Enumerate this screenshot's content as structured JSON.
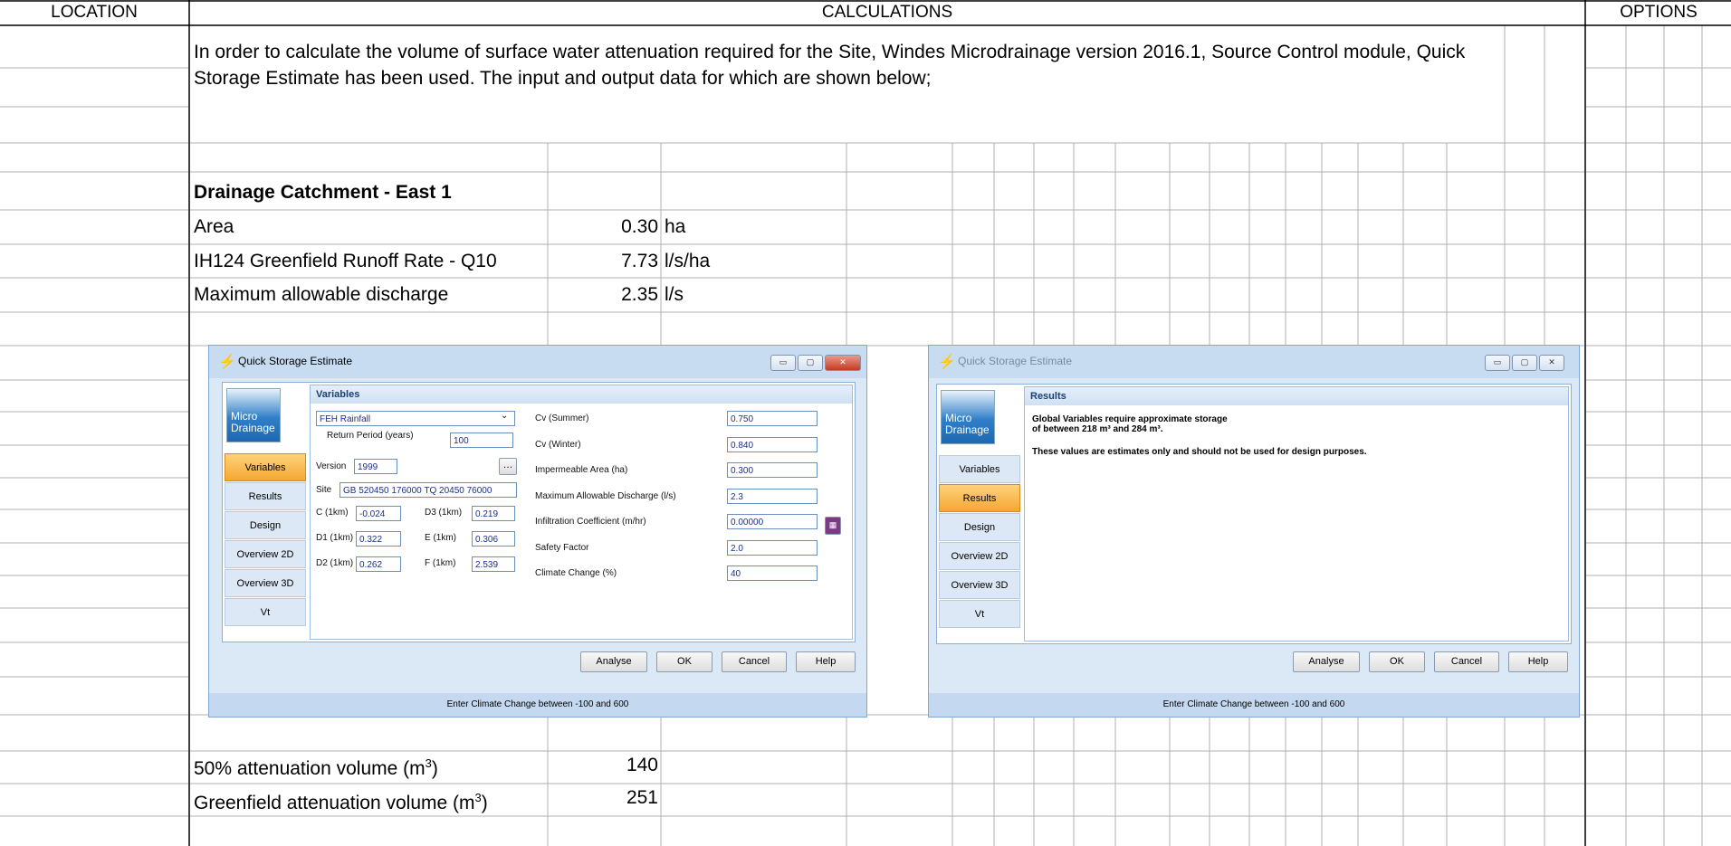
{
  "headers": {
    "location": "LOCATION",
    "calculations": "CALCULATIONS",
    "options": "OPTIONS"
  },
  "intro": "In order to calculate the volume of surface water attenuation required for the Site, Windes Microdrainage version 2016.1, Source Control module, Quick Storage Estimate has been used. The input and output data for which are shown below;",
  "catchment": {
    "title": "Drainage Catchment - East 1",
    "rows": [
      {
        "label": "Area",
        "value": "0.30",
        "unit": "ha"
      },
      {
        "label": "IH124 Greenfield Runoff Rate - Q10",
        "value": "7.73",
        "unit": "l/s/ha"
      },
      {
        "label": "Maximum allowable discharge",
        "value": "2.35",
        "unit": "l/s"
      }
    ]
  },
  "volumes": {
    "v50_label": "50% attenuation volume (m",
    "v50_sup": "3",
    "v50_close": ")",
    "v50_value": "140",
    "gf_label": "Greenfield attenuation volume (m",
    "gf_sup": "3",
    "gf_close": ")",
    "gf_value": "251"
  },
  "dialog1": {
    "title": "Quick Storage Estimate",
    "logo": "Micro Drainage",
    "pane_title": "Variables",
    "nav": [
      "Variables",
      "Results",
      "Design",
      "Overview 2D",
      "Overview 3D",
      "Vt"
    ],
    "selected_nav": "Variables",
    "rainfall": "FEH Rainfall",
    "return_period_label": "Return Period (years)",
    "return_period": "100",
    "version_label": "Version",
    "version": "1999",
    "site_label": "Site",
    "site": "GB 520450 176000 TQ 20450 76000",
    "c_label": "C (1km)",
    "c": "-0.024",
    "d3_label": "D3 (1km)",
    "d3": "0.219",
    "d1_label": "D1 (1km)",
    "d1": "0.322",
    "e_label": "E (1km)",
    "e": "0.306",
    "d2_label": "D2 (1km)",
    "d2": "0.262",
    "f_label": "F (1km)",
    "f": "2.539",
    "right_fields": [
      {
        "label": "Cv (Summer)",
        "value": "0.750"
      },
      {
        "label": "Cv (Winter)",
        "value": "0.840"
      },
      {
        "label": "Impermeable Area (ha)",
        "value": "0.300"
      },
      {
        "label": "Maximum Allowable Discharge (l/s)",
        "value": "2.3"
      },
      {
        "label": "Infiltration Coefficient (m/hr)",
        "value": "0.00000"
      },
      {
        "label": "Safety Factor",
        "value": "2.0"
      },
      {
        "label": "Climate Change (%)",
        "value": "40"
      }
    ],
    "buttons": [
      "Analyse",
      "OK",
      "Cancel",
      "Help"
    ],
    "status": "Enter Climate Change between -100 and 600"
  },
  "dialog2": {
    "title": "Quick Storage Estimate",
    "logo": "Micro Drainage",
    "pane_title": "Results",
    "nav": [
      "Variables",
      "Results",
      "Design",
      "Overview 2D",
      "Overview 3D",
      "Vt"
    ],
    "selected_nav": "Results",
    "result_line1": "Global Variables require approximate storage",
    "result_line2": "of between 218 m³ and 284 m³.",
    "result_note": "These values are estimates only and should not be used for design purposes.",
    "buttons": [
      "Analyse",
      "OK",
      "Cancel",
      "Help"
    ],
    "status": "Enter Climate Change between -100 and 600"
  },
  "colors": {
    "grid_major": "#000000",
    "grid_minor": "#b0b0b0",
    "dialog_bg": "#dbe8f6",
    "nav_selected": "#f4a733"
  }
}
